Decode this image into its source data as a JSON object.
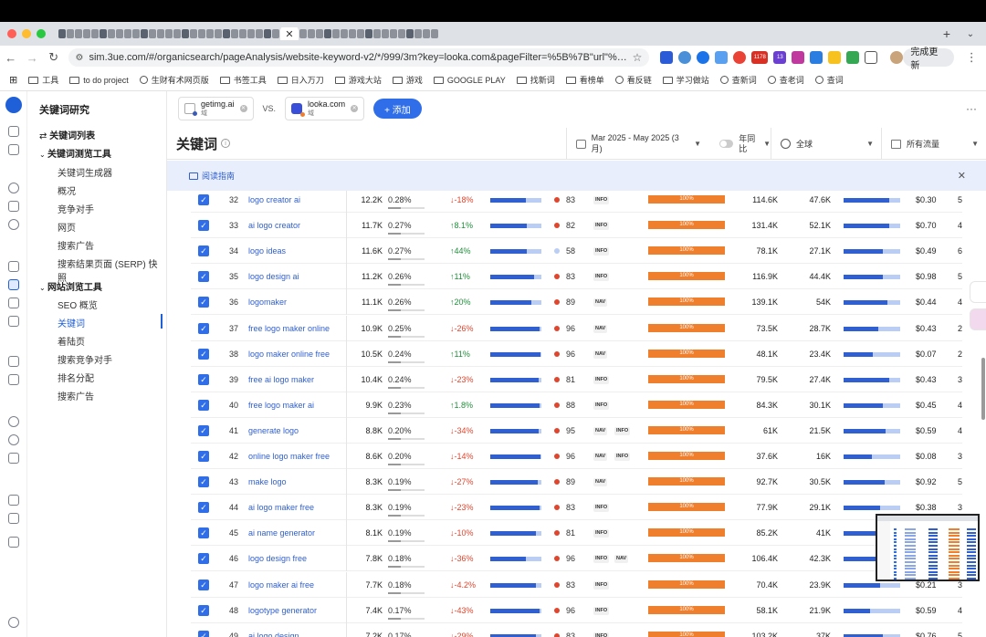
{
  "browser": {
    "active_tab_close": "✕",
    "url": "sim.3ue.com/#/organicsearch/pageAnalysis/website-keyword-v2/*/999/3m?key=looka.com&pageFilter=%5B%7B\"url\"%3A\"getimg.ai\"%2C\"sear...",
    "update_button": "完成更新",
    "ext_badges": [
      "1178",
      "13"
    ]
  },
  "bookmarks": [
    {
      "label": "工具",
      "type": "folder"
    },
    {
      "label": "to do project",
      "type": "folder"
    },
    {
      "label": "生财有术网页版",
      "type": "site"
    },
    {
      "label": "书签工具",
      "type": "folder"
    },
    {
      "label": "日入万刀",
      "type": "folder"
    },
    {
      "label": "游戏大站",
      "type": "folder"
    },
    {
      "label": "游戏",
      "type": "folder"
    },
    {
      "label": "GOOGLE PLAY",
      "type": "folder"
    },
    {
      "label": "找新词",
      "type": "folder"
    },
    {
      "label": "看榜单",
      "type": "folder"
    },
    {
      "label": "看反链",
      "type": "site"
    },
    {
      "label": "学习做站",
      "type": "folder"
    },
    {
      "label": "查新词",
      "type": "site"
    },
    {
      "label": "查老词",
      "type": "site"
    },
    {
      "label": "查词",
      "type": "site"
    }
  ],
  "sidebar": {
    "title": "关键词研究",
    "list_link": "关键词列表",
    "section1": "关键词测览工具",
    "section1_items": [
      "关键词生成器",
      "概况",
      "竞争对手",
      "网页",
      "搜索广告",
      "搜索结果页面 (SERP) 快照"
    ],
    "section2": "网站浏览工具",
    "section2_items": [
      "SEO 概览",
      "关键词",
      "着陆页",
      "搜索竞争对手",
      "排名分配",
      "搜索广告"
    ]
  },
  "compare": {
    "site1": "getimg.ai",
    "site1_sub": "域",
    "vs": "VS.",
    "site2": "looka.com",
    "site2_sub": "域",
    "add_label": "+ 添加"
  },
  "header": {
    "title": "关键词",
    "date_range": "Mar 2025 - May 2025 (3 月)",
    "yoy": "年同比",
    "region": "全球",
    "traffic": "所有流量"
  },
  "guide": {
    "label": "阅读指南",
    "close": "✕"
  },
  "table": {
    "rows": [
      {
        "n": "32",
        "kw": "logo creator ai",
        "vol": "12.2K",
        "share": "0.28%",
        "chg": "-18%",
        "dir": "down",
        "b1": 0.7,
        "kd": "83",
        "kdc": "#e0452d",
        "tags": [
          "INFO"
        ],
        "orange": "100%",
        "v1": "114.6K",
        "v2": "47.6K",
        "b2": 0.8,
        "cpc": "$0.30",
        "clip": "5"
      },
      {
        "n": "33",
        "kw": "ai logo creator",
        "vol": "11.7K",
        "share": "0.27%",
        "chg": "8.1%",
        "dir": "up",
        "b1": 0.72,
        "kd": "82",
        "kdc": "#e0452d",
        "tags": [
          "INFO"
        ],
        "orange": "100%",
        "v1": "131.4K",
        "v2": "52.1K",
        "b2": 0.8,
        "cpc": "$0.70",
        "clip": "4"
      },
      {
        "n": "34",
        "kw": "logo ideas",
        "vol": "11.6K",
        "share": "0.27%",
        "chg": "44%",
        "dir": "up",
        "b1": 0.72,
        "kd": "58",
        "kdc": "#b9cdf5",
        "tags": [
          "INFO"
        ],
        "orange": "100%",
        "v1": "78.1K",
        "v2": "27.1K",
        "b2": 0.7,
        "cpc": "$0.49",
        "clip": "6"
      },
      {
        "n": "35",
        "kw": "logo design ai",
        "vol": "11.2K",
        "share": "0.26%",
        "chg": "11%",
        "dir": "up",
        "b1": 0.86,
        "kd": "83",
        "kdc": "#e0452d",
        "tags": [
          "INFO"
        ],
        "orange": "100%",
        "v1": "116.9K",
        "v2": "44.4K",
        "b2": 0.7,
        "cpc": "$0.98",
        "clip": "5"
      },
      {
        "n": "36",
        "kw": "logomaker",
        "vol": "11.1K",
        "share": "0.26%",
        "chg": "20%",
        "dir": "up",
        "b1": 0.8,
        "kd": "89",
        "kdc": "#e0452d",
        "tags": [
          "NAV"
        ],
        "orange": "100%",
        "v1": "139.1K",
        "v2": "54K",
        "b2": 0.78,
        "cpc": "$0.44",
        "clip": "4"
      },
      {
        "n": "37",
        "kw": "free logo maker online",
        "vol": "10.9K",
        "share": "0.25%",
        "chg": "-26%",
        "dir": "down",
        "b1": 0.96,
        "kd": "96",
        "kdc": "#e0452d",
        "tags": [
          "NAV"
        ],
        "orange": "100%",
        "v1": "73.5K",
        "v2": "28.7K",
        "b2": 0.62,
        "cpc": "$0.43",
        "clip": "2"
      },
      {
        "n": "38",
        "kw": "logo maker online free",
        "vol": "10.5K",
        "share": "0.24%",
        "chg": "11%",
        "dir": "up",
        "b1": 0.98,
        "kd": "96",
        "kdc": "#e0452d",
        "tags": [
          "NAV"
        ],
        "orange": "100%",
        "v1": "48.1K",
        "v2": "23.4K",
        "b2": 0.52,
        "cpc": "$0.07",
        "clip": "2"
      },
      {
        "n": "39",
        "kw": "free ai logo maker",
        "vol": "10.4K",
        "share": "0.24%",
        "chg": "-23%",
        "dir": "down",
        "b1": 0.94,
        "kd": "81",
        "kdc": "#e0452d",
        "tags": [
          "INFO"
        ],
        "orange": "100%",
        "v1": "79.5K",
        "v2": "27.4K",
        "b2": 0.8,
        "cpc": "$0.43",
        "clip": "3"
      },
      {
        "n": "40",
        "kw": "free logo maker ai",
        "vol": "9.9K",
        "share": "0.23%",
        "chg": "1.8%",
        "dir": "up",
        "b1": 0.96,
        "kd": "88",
        "kdc": "#e0452d",
        "tags": [
          "INFO"
        ],
        "orange": "100%",
        "v1": "84.3K",
        "v2": "30.1K",
        "b2": 0.7,
        "cpc": "$0.45",
        "clip": "4"
      },
      {
        "n": "41",
        "kw": "generate logo",
        "vol": "8.8K",
        "share": "0.20%",
        "chg": "-34%",
        "dir": "down",
        "b1": 0.94,
        "kd": "95",
        "kdc": "#e0452d",
        "tags": [
          "NAV",
          "INFO"
        ],
        "orange": "100%",
        "v1": "61K",
        "v2": "21.5K",
        "b2": 0.74,
        "cpc": "$0.59",
        "clip": "4"
      },
      {
        "n": "42",
        "kw": "online logo maker free",
        "vol": "8.6K",
        "share": "0.20%",
        "chg": "-14%",
        "dir": "down",
        "b1": 0.98,
        "kd": "96",
        "kdc": "#e0452d",
        "tags": [
          "NAV",
          "INFO"
        ],
        "orange": "100%",
        "v1": "37.6K",
        "v2": "16K",
        "b2": 0.5,
        "cpc": "$0.08",
        "clip": "3"
      },
      {
        "n": "43",
        "kw": "make logo",
        "vol": "8.3K",
        "share": "0.19%",
        "chg": "-27%",
        "dir": "down",
        "b1": 0.92,
        "kd": "89",
        "kdc": "#e0452d",
        "tags": [
          "NAV"
        ],
        "orange": "100%",
        "v1": "92.7K",
        "v2": "30.5K",
        "b2": 0.72,
        "cpc": "$0.92",
        "clip": "5"
      },
      {
        "n": "44",
        "kw": "ai logo maker free",
        "vol": "8.3K",
        "share": "0.19%",
        "chg": "-23%",
        "dir": "down",
        "b1": 0.96,
        "kd": "83",
        "kdc": "#e0452d",
        "tags": [
          "INFO"
        ],
        "orange": "100%",
        "v1": "77.9K",
        "v2": "29.1K",
        "b2": 0.64,
        "cpc": "$0.38",
        "clip": "3"
      },
      {
        "n": "45",
        "kw": "ai name generator",
        "vol": "8.1K",
        "share": "0.19%",
        "chg": "-10%",
        "dir": "down",
        "b1": 0.9,
        "kd": "81",
        "kdc": "#e0452d",
        "tags": [
          "INFO"
        ],
        "orange": "100%",
        "v1": "85.2K",
        "v2": "41K",
        "b2": 0.7,
        "cpc": "",
        "clip": ""
      },
      {
        "n": "46",
        "kw": "logo design free",
        "vol": "7.8K",
        "share": "0.18%",
        "chg": "-36%",
        "dir": "down",
        "b1": 0.7,
        "kd": "96",
        "kdc": "#e0452d",
        "tags": [
          "INFO",
          "NAV"
        ],
        "orange": "100%",
        "v1": "106.4K",
        "v2": "42.3K",
        "b2": 0.7,
        "cpc": "",
        "clip": ""
      },
      {
        "n": "47",
        "kw": "logo maker ai free",
        "vol": "7.7K",
        "share": "0.18%",
        "chg": "-4.2%",
        "dir": "down",
        "b1": 0.9,
        "kd": "83",
        "kdc": "#e0452d",
        "tags": [
          "INFO"
        ],
        "orange": "100%",
        "v1": "70.4K",
        "v2": "23.9K",
        "b2": 0.64,
        "cpc": "$0.21",
        "clip": "3"
      },
      {
        "n": "48",
        "kw": "logotype generator",
        "vol": "7.4K",
        "share": "0.17%",
        "chg": "-43%",
        "dir": "down",
        "b1": 0.96,
        "kd": "96",
        "kdc": "#e0452d",
        "tags": [
          "INFO"
        ],
        "orange": "100%",
        "v1": "58.1K",
        "v2": "21.9K",
        "b2": 0.46,
        "cpc": "$0.59",
        "clip": "4"
      },
      {
        "n": "49",
        "kw": "ai logo design",
        "vol": "7.2K",
        "share": "0.17%",
        "chg": "-29%",
        "dir": "down",
        "b1": 0.9,
        "kd": "83",
        "kdc": "#e0452d",
        "tags": [
          "INFO"
        ],
        "orange": "100%",
        "v1": "103.2K",
        "v2": "37K",
        "b2": 0.7,
        "cpc": "$0.76",
        "clip": "5"
      }
    ]
  }
}
